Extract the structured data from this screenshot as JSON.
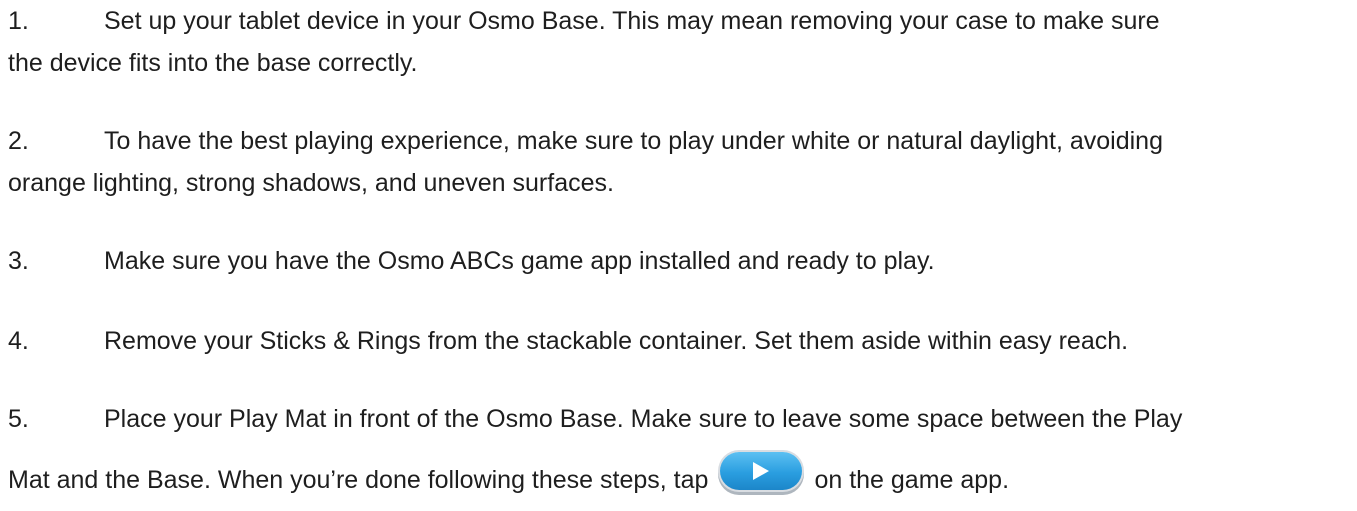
{
  "steps": [
    {
      "number": "1.",
      "line1": "Set up your tablet device in your Osmo Base. This may mean removing your case to make sure",
      "line2": "the device fits into the base correctly."
    },
    {
      "number": "2.",
      "line1": "To have the best playing experience, make sure to play under white or natural daylight, avoiding",
      "line2": "orange lighting, strong shadows, and uneven surfaces."
    },
    {
      "number": "3.",
      "line1": "Make sure you have the Osmo ABCs game app installed and ready to play."
    },
    {
      "number": "4.",
      "line1": "Remove your Sticks & Rings from the stackable container. Set them aside within easy reach."
    },
    {
      "number": "5.",
      "line1": "Place your Play Mat in front of the Osmo Base. Make sure to leave some space between the Play",
      "line2_before_icon": "Mat and the Base. When you’re done following these steps, tap",
      "icon": "play-button-icon",
      "line2_after_icon": "on the game app."
    }
  ],
  "colors": {
    "text": "#1e1e1e",
    "play_button": "#2a9ee0"
  }
}
